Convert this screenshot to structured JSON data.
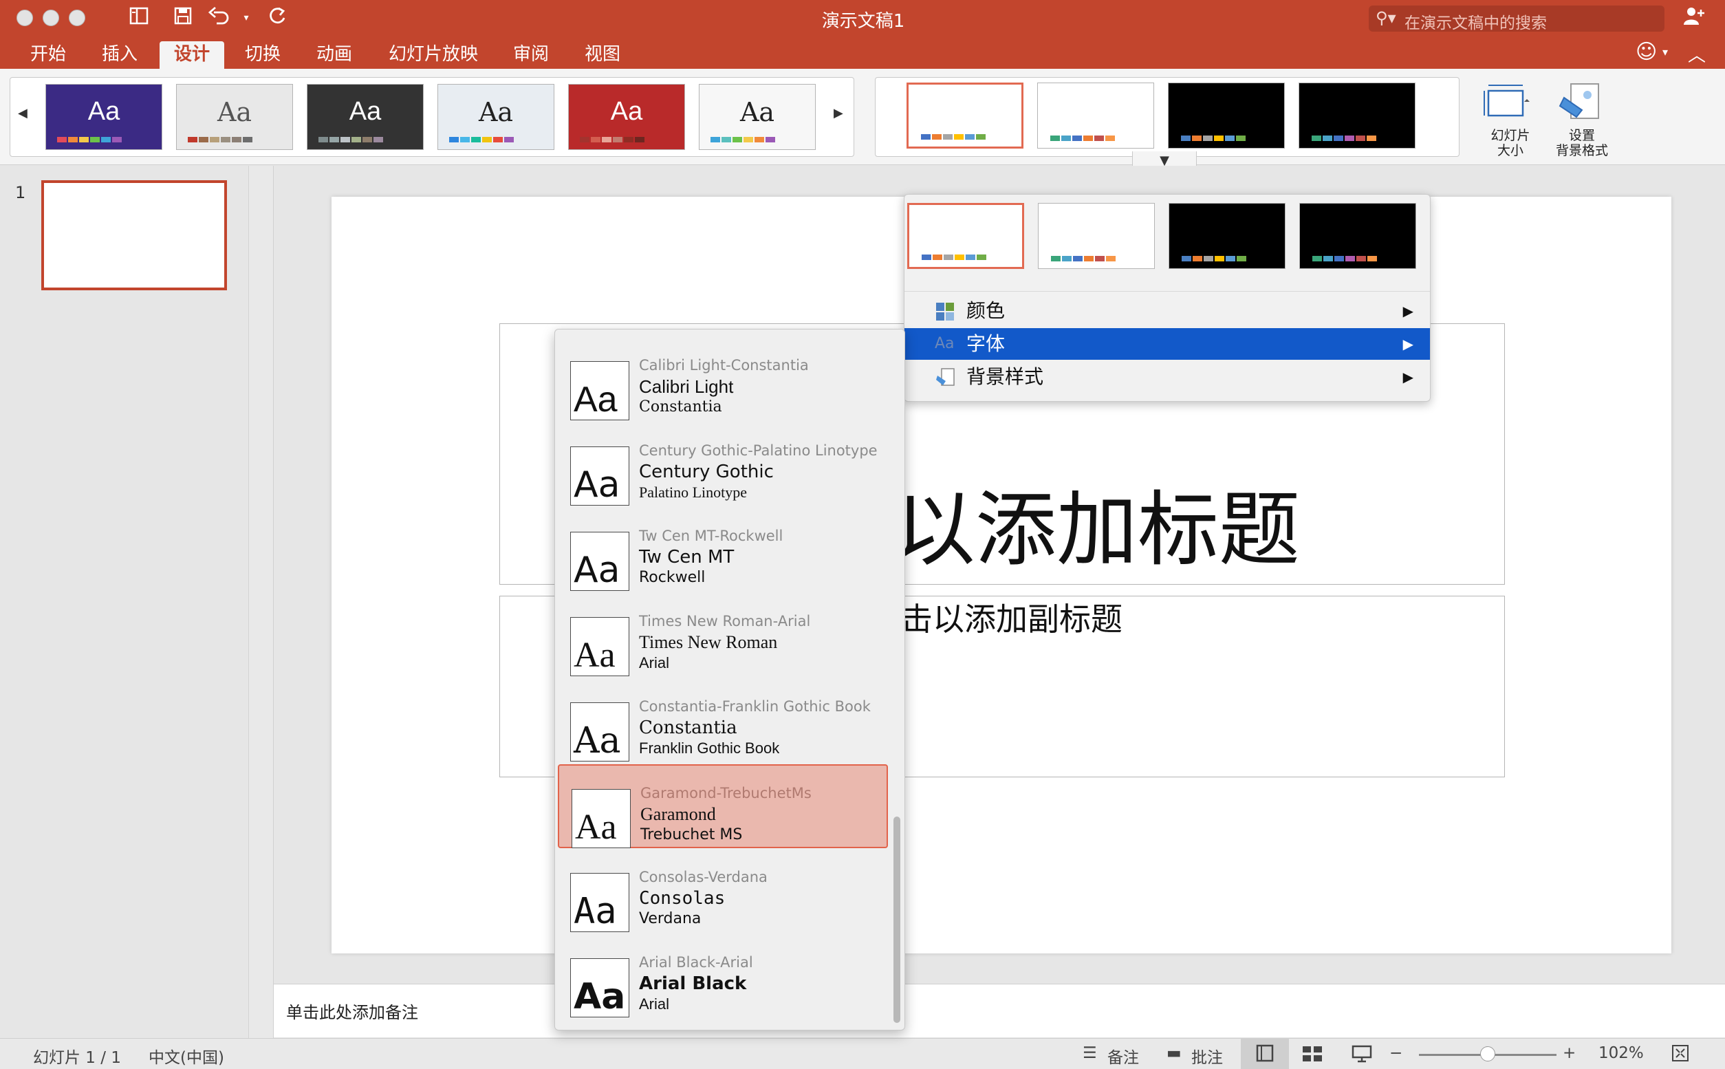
{
  "titlebar": {
    "doc_title": "演示文稿1",
    "search_placeholder": "在演示文稿中的搜索"
  },
  "tabs": [
    "开始",
    "插入",
    "设计",
    "切换",
    "动画",
    "幻灯片放映",
    "审阅",
    "视图"
  ],
  "active_tab": "设计",
  "ribbon": {
    "themes": [
      {
        "text": "Aa",
        "bg": "#3b2a84",
        "fg": "#ffffff",
        "swatches": [
          "#e24b5a",
          "#f08a3a",
          "#f3c94a",
          "#6cc24a",
          "#3ea4d9",
          "#9b59b6"
        ]
      },
      {
        "text": "Aa",
        "bg": "#e8e8e8",
        "fg": "#555555",
        "swatches": [
          "#c0392b",
          "#9b6b4a",
          "#b7a07a",
          "#9a8f80",
          "#8c7f75",
          "#6d6d6d"
        ]
      },
      {
        "text": "Aa",
        "bg": "#333333",
        "fg": "#ffffff",
        "swatches": [
          "#7f8c8d",
          "#95a5a6",
          "#bdc3c7",
          "#a3b18a",
          "#8e7d6b",
          "#9c8a9e"
        ]
      },
      {
        "text": "Aa",
        "bg": "#e8edf2",
        "fg": "#222222",
        "swatches": [
          "#2e86de",
          "#48b7e8",
          "#1abc9c",
          "#f1c40f",
          "#e74c3c",
          "#9b59b6"
        ]
      },
      {
        "text": "Aa",
        "bg": "#b92a2a",
        "fg": "#ffffff",
        "swatches": [
          "#a3332e",
          "#d35d4f",
          "#e8a598",
          "#c27c70",
          "#8f2c24",
          "#6e2620"
        ]
      },
      {
        "text": "Aa",
        "bg": "#f7f7f7",
        "fg": "#222222",
        "swatches": [
          "#3ea4d9",
          "#5bc0be",
          "#6cc24a",
          "#f3c94a",
          "#f08a3a",
          "#9b59b6"
        ]
      }
    ],
    "variants": [
      {
        "bg": "#ffffff",
        "swatches": [
          "#4472c4",
          "#ed7d31",
          "#a5a5a5",
          "#ffc000",
          "#5b9bd5",
          "#70ad47"
        ]
      },
      {
        "bg": "#ffffff",
        "swatches": [
          "#3aa57a",
          "#4aa3c8",
          "#4472c4",
          "#ed7d31",
          "#c0504d",
          "#f79646"
        ]
      },
      {
        "bg": "#000000",
        "swatches": [
          "#4a7fc1",
          "#ed7d31",
          "#a5a5a5",
          "#ffc000",
          "#5b9bd5",
          "#70ad47"
        ]
      },
      {
        "bg": "#000000",
        "swatches": [
          "#3aa57a",
          "#4aa3c8",
          "#4472c4",
          "#b05cb0",
          "#c0504d",
          "#f79646"
        ]
      }
    ],
    "slide_size_label": "幻灯片\n大小",
    "format_background_label": "设置\n背景格式"
  },
  "variant_menu": {
    "items": [
      {
        "label": "颜色",
        "icon": "color-grid-icon"
      },
      {
        "label": "字体",
        "icon": "font-aa-icon",
        "highlighted": true
      },
      {
        "label": "背景样式",
        "icon": "background-style-icon"
      }
    ]
  },
  "font_schemes": [
    {
      "scheme": "Calibri Light-Constantia",
      "heading": "Calibri Light",
      "body": "Constantia"
    },
    {
      "scheme": "Century Gothic-Palatino Linotype",
      "heading": "Century Gothic",
      "body": "Palatino Linotype"
    },
    {
      "scheme": "Tw Cen MT-Rockwell",
      "heading": "Tw Cen MT",
      "body": "Rockwell"
    },
    {
      "scheme": "Times New Roman-Arial",
      "heading": "Times New Roman",
      "body": "Arial"
    },
    {
      "scheme": "Constantia-Franklin Gothic Book",
      "heading": "Constantia",
      "body": "Franklin Gothic Book"
    },
    {
      "scheme": "Garamond-TrebuchetMs",
      "heading": "Garamond",
      "body": "Trebuchet MS",
      "selected": true
    },
    {
      "scheme": "Consolas-Verdana",
      "heading": "Consolas",
      "body": "Verdana"
    },
    {
      "scheme": "Arial Black-Arial",
      "heading": "Arial Black",
      "body": "Arial"
    }
  ],
  "font_preview_text": "Aa",
  "slide_panel": {
    "slide_number": "1"
  },
  "slide": {
    "title_placeholder": "以添加标题",
    "subtitle_placeholder": "击以添加副标题"
  },
  "notes_placeholder": "单击此处添加备注",
  "statusbar": {
    "slide_info": "幻灯片 1 / 1",
    "language": "中文(中国)",
    "notes_label": "备注",
    "comments_label": "批注",
    "zoom": "102%"
  }
}
